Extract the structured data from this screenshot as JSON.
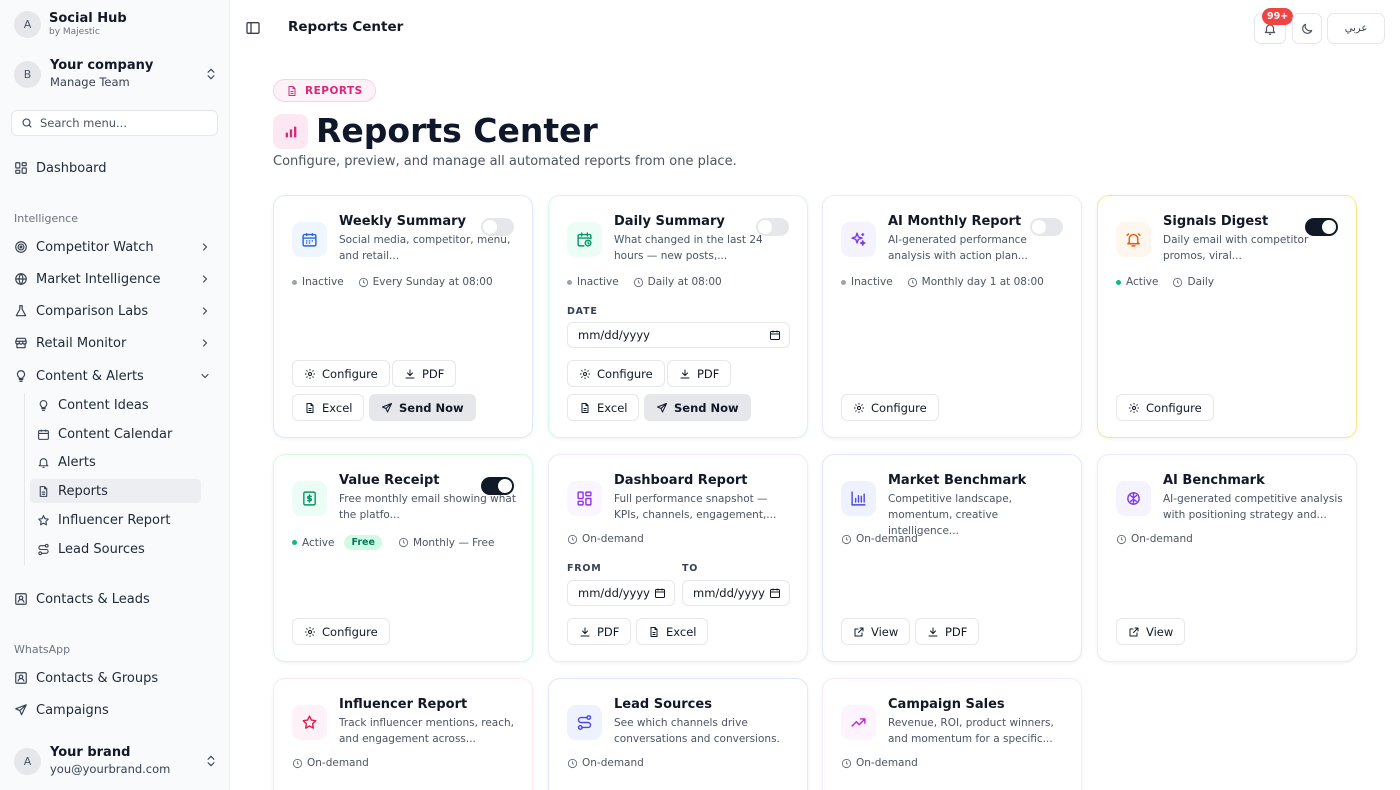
{
  "brand": {
    "initial": "A",
    "title": "Social Hub",
    "subtitle": "by Majestic"
  },
  "company": {
    "initial": "B",
    "name": "Your company",
    "role": "Manage Team"
  },
  "search": {
    "placeholder": "Search menu..."
  },
  "nav": {
    "dashboard": "Dashboard",
    "section_intelligence": "Intelligence",
    "competitor_watch": "Competitor Watch",
    "market_intelligence": "Market Intelligence",
    "comparison_labs": "Comparison Labs",
    "retail_monitor": "Retail Monitor",
    "content_alerts": "Content & Alerts",
    "sub": [
      "Content Ideas",
      "Content Calendar",
      "Alerts",
      "Reports",
      "Influencer Report",
      "Lead Sources"
    ],
    "contacts_leads": "Contacts & Leads",
    "section_whatsapp": "WhatsApp",
    "contacts_groups": "Contacts & Groups",
    "campaigns": "Campaigns"
  },
  "user": {
    "initial": "A",
    "name": "Your brand",
    "email": "you@yourbrand.com"
  },
  "topbar": {
    "title": "Reports Center",
    "notif_badge": "99+",
    "lang": "عربي"
  },
  "header": {
    "pill": "REPORTS",
    "title": "Reports Center",
    "subtitle": "Configure, preview, and manage all automated reports from one place."
  },
  "labels": {
    "configure": "Configure",
    "pdf": "PDF",
    "excel": "Excel",
    "send_now": "Send Now",
    "view": "View",
    "date": "DATE",
    "from": "FROM",
    "to": "TO",
    "date_placeholder": "mm/dd/yyyy",
    "inactive": "Inactive",
    "active": "Active",
    "on_demand": "On-demand",
    "free": "Free"
  },
  "cards": {
    "weekly": {
      "title": "Weekly Summary",
      "desc": "Social media, competitor, menu, and retail...",
      "schedule": "Every Sunday at 08:00",
      "enabled": false
    },
    "daily": {
      "title": "Daily Summary",
      "desc": "What changed in the last 24 hours — new posts,...",
      "schedule": "Daily at 08:00",
      "enabled": false
    },
    "ai_monthly": {
      "title": "AI Monthly Report",
      "desc": "AI-generated performance analysis with action plan...",
      "schedule": "Monthly day 1 at 08:00",
      "enabled": false
    },
    "signals": {
      "title": "Signals Digest",
      "desc": "Daily email with competitor promos, viral...",
      "schedule": "Daily",
      "enabled": true
    },
    "value_receipt": {
      "title": "Value Receipt",
      "desc": "Free monthly email showing what the platfo...",
      "schedule": "Monthly — Free",
      "enabled": true
    },
    "dashboard": {
      "title": "Dashboard Report",
      "desc": "Full performance snapshot — KPIs, channels, engagement,..."
    },
    "market": {
      "title": "Market Benchmark",
      "desc": "Competitive landscape, momentum, creative intelligence..."
    },
    "ai_benchmark": {
      "title": "AI Benchmark",
      "desc": "AI-generated competitive analysis with positioning strategy and..."
    },
    "influencer": {
      "title": "Influencer Report",
      "desc": "Track influencer mentions, reach, and engagement across..."
    },
    "lead_sources": {
      "title": "Lead Sources",
      "desc": "See which channels drive conversations and conversions."
    },
    "campaign": {
      "title": "Campaign Sales",
      "desc": "Revenue, ROI, product winners, and momentum for a specific..."
    }
  },
  "colors": {
    "accent": "#db2777",
    "active_dot": "#10b981",
    "badge": "#ef4444"
  }
}
